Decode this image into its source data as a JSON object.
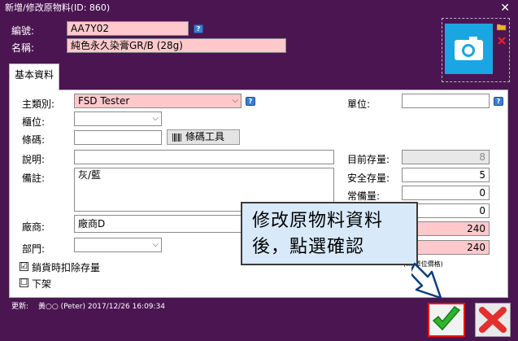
{
  "window": {
    "title": "新增/修改原物料(ID: 860)",
    "close_glyph": "✕"
  },
  "header": {
    "code_label": "編號:",
    "code_value": "AA7Y02",
    "name_label": "名稱:",
    "name_value": "純色永久染膏GR/B (28g)"
  },
  "tabs": [
    {
      "label": "基本資料"
    }
  ],
  "form": {
    "category_label": "主類別:",
    "category_value": "FSD Tester",
    "cabinet_label": "櫃位:",
    "cabinet_value": "",
    "barcode_label": "條碼:",
    "barcode_value": "",
    "barcode_tool_label": "條碼工具",
    "desc_label": "說明:",
    "desc_value": "",
    "note_label": "備註:",
    "note_value": "灰/藍",
    "vendor_label": "廠商:",
    "vendor_value": "廠商D",
    "dept_label": "部門:",
    "dept_value": "",
    "checkbox_deduct_label": "銷貨時扣除存量",
    "checkbox_deduct_checked": "☑",
    "checkbox_off_label": "下架",
    "checkbox_off_checked": "☐",
    "unit_label": "單位:",
    "unit_value": "",
    "stock_label": "目前存量:",
    "stock_value": "8",
    "safety_label": "安全存量:",
    "safety_value": "5",
    "reserve_label": "常備量:",
    "reserve_value": "0",
    "field_r4_value": "0",
    "field_r5_value": "240",
    "field_r6_value": "240",
    "small_note": "(… 單位價格)"
  },
  "callout": {
    "line1": "修改原物料資料",
    "line2": "後，點選確認"
  },
  "footer": {
    "updated_label": "更新:",
    "updated_value": "黃○○ (Peter) 2017/12/26 16:09:34"
  },
  "icons": {
    "help": "?",
    "dropdown": "⌵",
    "ok": "checkmark-icon",
    "cancel": "x-icon"
  },
  "colors": {
    "window_bg": "#4b1552",
    "required_pink": "#ffc9cc",
    "callout_bg": "#d8e9f9",
    "ok_border": "#e11111",
    "ok_green": "#2db52d",
    "cancel_red": "#e23030",
    "camera_blue": "#1aa6e3"
  }
}
